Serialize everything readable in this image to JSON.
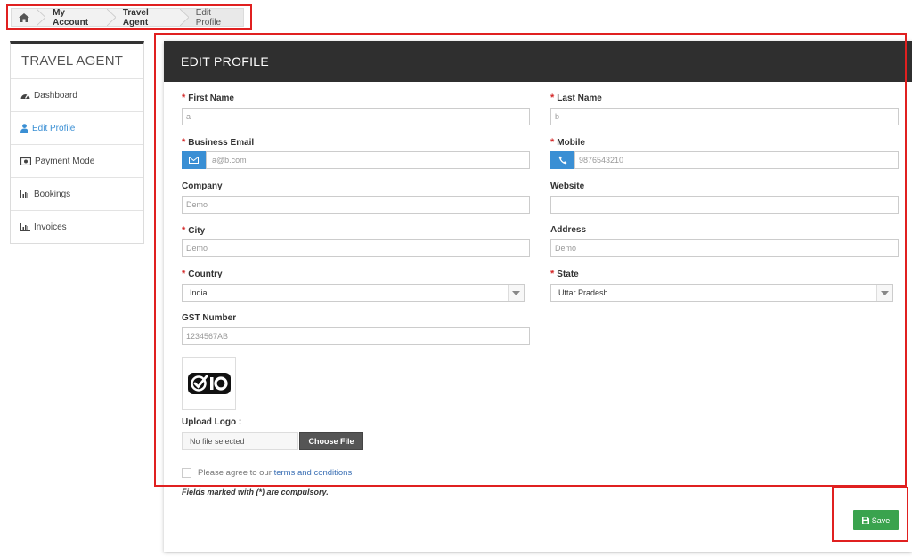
{
  "breadcrumb": {
    "items": [
      "My Account",
      "Travel Agent",
      "Edit Profile"
    ]
  },
  "sidebar": {
    "title": "TRAVEL AGENT",
    "items": [
      {
        "label": "Dashboard",
        "icon": "dashboard-icon"
      },
      {
        "label": "Edit Profile",
        "icon": "user-icon",
        "active": true
      },
      {
        "label": "Payment Mode",
        "icon": "money-icon"
      },
      {
        "label": "Bookings",
        "icon": "bar-chart-icon"
      },
      {
        "label": "Invoices",
        "icon": "bar-chart-icon"
      }
    ]
  },
  "panel": {
    "title": "EDIT PROFILE"
  },
  "form": {
    "first_name": {
      "label": "First Name",
      "value": "a"
    },
    "last_name": {
      "label": "Last Name",
      "value": "b"
    },
    "business_email": {
      "label": "Business Email",
      "value": "a@b.com"
    },
    "mobile": {
      "label": "Mobile",
      "value": "9876543210"
    },
    "company": {
      "label": "Company",
      "value": "Demo"
    },
    "website": {
      "label": "Website",
      "value": ""
    },
    "city": {
      "label": "City",
      "value": "Demo"
    },
    "address": {
      "label": "Address",
      "value": "Demo"
    },
    "country": {
      "label": "Country",
      "value": "India"
    },
    "state": {
      "label": "State",
      "value": "Uttar Pradesh"
    },
    "gst_number": {
      "label": "GST Number",
      "value": "1234567AB"
    },
    "upload_logo": {
      "label": "Upload Logo :",
      "file_status": "No file selected",
      "button": "Choose File"
    },
    "agree": {
      "text": "Please agree to our",
      "link": "terms and conditions"
    },
    "compulsory_note": "Fields marked with (*) are compulsory.",
    "save_label": "Save"
  },
  "colors": {
    "header_bg": "#2f2f2f",
    "accent_blue": "#3a8fd4",
    "save_green": "#3aa34e",
    "required_red": "#d42a2a",
    "highlight_red": "#e02020"
  }
}
